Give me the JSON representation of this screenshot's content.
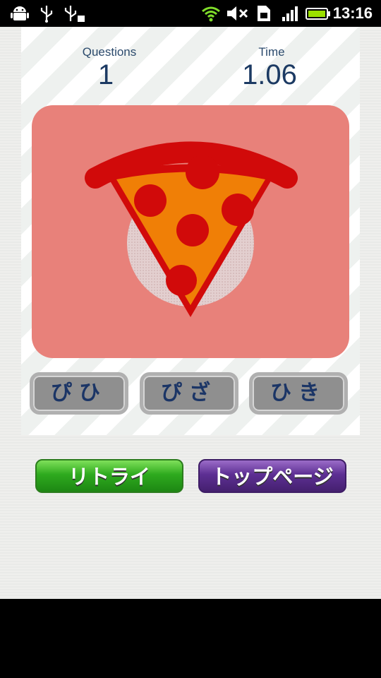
{
  "status_bar": {
    "time": "13:16",
    "icons": [
      "android-icon",
      "usb-icon",
      "usb-debug-icon",
      "wifi-icon",
      "mute-icon",
      "sim-icon",
      "signal-icon",
      "battery-icon"
    ]
  },
  "stats": {
    "questions_label": "Questions",
    "questions_value": "1",
    "time_label": "Time",
    "time_value": "1.06"
  },
  "picture": {
    "subject": "pizza-slice",
    "background_color": "#e8817a"
  },
  "choices": [
    "ぴひ",
    "ぴざ",
    "ひき"
  ],
  "buttons": {
    "retry": "リトライ",
    "top_page": "トップページ"
  },
  "colors": {
    "label": "#2b4a6c",
    "value": "#1c3a63",
    "retry_green": "#2eaa1e",
    "top_purple": "#5d2f93"
  }
}
